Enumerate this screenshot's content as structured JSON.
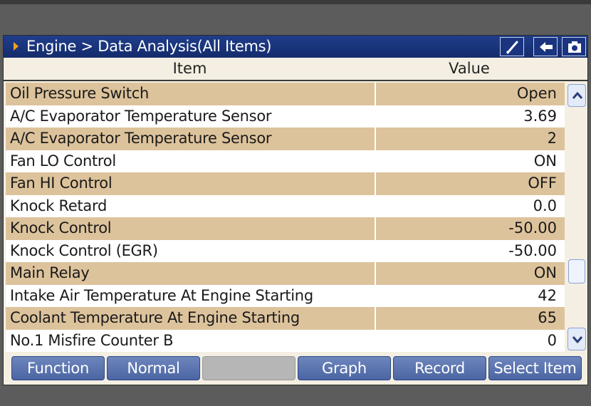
{
  "breadcrumb": "Engine > Data Analysis(All Items)",
  "toolbar_icons": [
    "brush-icon",
    "back-arrow-icon",
    "camera-icon"
  ],
  "columns": {
    "item": "Item",
    "value": "Value"
  },
  "rows": [
    {
      "name": "Oil Pressure Switch",
      "value": "Open"
    },
    {
      "name": "A/C Evaporator Temperature Sensor",
      "value": "3.69"
    },
    {
      "name": "A/C Evaporator Temperature Sensor",
      "value": "2"
    },
    {
      "name": "Fan LO Control",
      "value": "ON"
    },
    {
      "name": "Fan HI Control",
      "value": "OFF"
    },
    {
      "name": "Knock Retard",
      "value": "0.0"
    },
    {
      "name": "Knock Control",
      "value": "-50.00"
    },
    {
      "name": "Knock Control (EGR)",
      "value": "-50.00"
    },
    {
      "name": "Main Relay",
      "value": "ON"
    },
    {
      "name": "Intake Air Temperature At Engine Starting",
      "value": "42"
    },
    {
      "name": "Coolant Temperature At Engine Starting",
      "value": "65"
    },
    {
      "name": "No.1 Misfire Counter B",
      "value": "0"
    }
  ],
  "footer_buttons": {
    "function": "Function",
    "normal": "Normal",
    "blank": "",
    "graph": "Graph",
    "record": "Record",
    "select_item": "Select Item"
  },
  "colors": {
    "title_bar": "#1f3d8a",
    "row_highlight": "#ddc39c",
    "button": "#5a74b0"
  }
}
